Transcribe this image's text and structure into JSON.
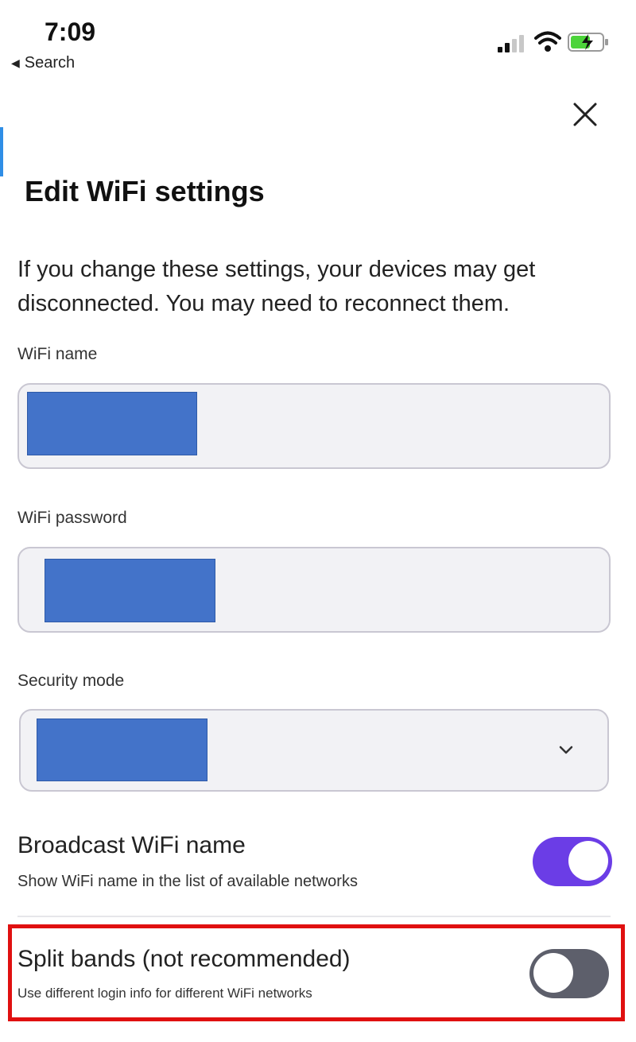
{
  "status_bar": {
    "time": "7:09",
    "back_label": "Search"
  },
  "header": {
    "title": "Edit WiFi settings",
    "description": "If you change these settings, your devices may get disconnected. You may need to reconnect them."
  },
  "fields": {
    "wifi_name": {
      "label": "WiFi name",
      "value": ""
    },
    "wifi_password": {
      "label": "WiFi password",
      "value": ""
    },
    "security_mode": {
      "label": "Security mode",
      "value": ""
    }
  },
  "toggles": {
    "broadcast": {
      "title": "Broadcast WiFi name",
      "subtitle": "Show WiFi name in the list of available networks",
      "on": true
    },
    "split_bands": {
      "title": "Split bands (not recommended)",
      "subtitle": "Use different login info for different WiFi networks",
      "on": false
    }
  },
  "colors": {
    "accent_toggle_on": "#6b3de6",
    "toggle_off": "#5d5f6b",
    "redaction": "#4373c9",
    "highlight_border": "#e01010"
  },
  "icons": [
    "cellular-signal-icon",
    "wifi-icon",
    "battery-charging-icon",
    "close-icon",
    "chevron-down-icon",
    "back-arrow-icon"
  ]
}
